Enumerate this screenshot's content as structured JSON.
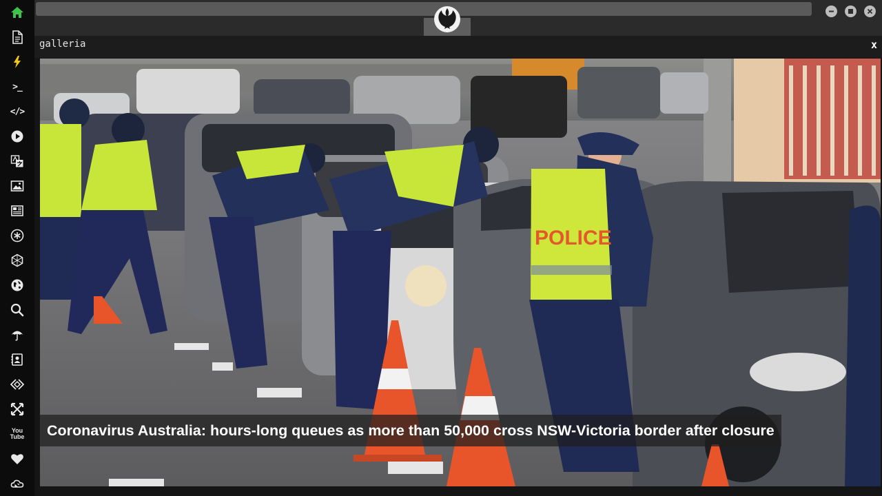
{
  "topbar": {
    "address_value": "",
    "emblem": "rebel-alliance-icon",
    "window_controls": [
      "minimize-icon",
      "maximize-icon",
      "close-icon"
    ]
  },
  "sidebar": {
    "items": [
      {
        "icon": "home-icon",
        "active": true,
        "color": "#3ec44a"
      },
      {
        "icon": "document-icon"
      },
      {
        "icon": "lightning-icon",
        "color": "#f2c811"
      },
      {
        "icon": "terminal-icon",
        "text": ">_"
      },
      {
        "icon": "code-icon",
        "text": "</>"
      },
      {
        "icon": "play-icon"
      },
      {
        "icon": "translate-icon"
      },
      {
        "icon": "image-icon"
      },
      {
        "icon": "news-icon"
      },
      {
        "icon": "asterisk-icon"
      },
      {
        "icon": "hexagon-icon"
      },
      {
        "icon": "globe-icon"
      },
      {
        "icon": "search-icon"
      },
      {
        "icon": "umbrella-icon"
      },
      {
        "icon": "contact-card-icon"
      },
      {
        "icon": "code-diamond-icon"
      },
      {
        "icon": "expand-icon"
      },
      {
        "icon": "youtube-icon",
        "text_top": "You",
        "text_bottom": "Tube"
      },
      {
        "icon": "heart-icon"
      },
      {
        "icon": "cloud-icon"
      }
    ]
  },
  "panel": {
    "title": "galleria",
    "close_label": "x"
  },
  "gallery": {
    "caption": "Coronavirus Australia: hours-long queues as more than 50,000 cross NSW-Victoria border after closure",
    "vest_text": "POLICE"
  }
}
